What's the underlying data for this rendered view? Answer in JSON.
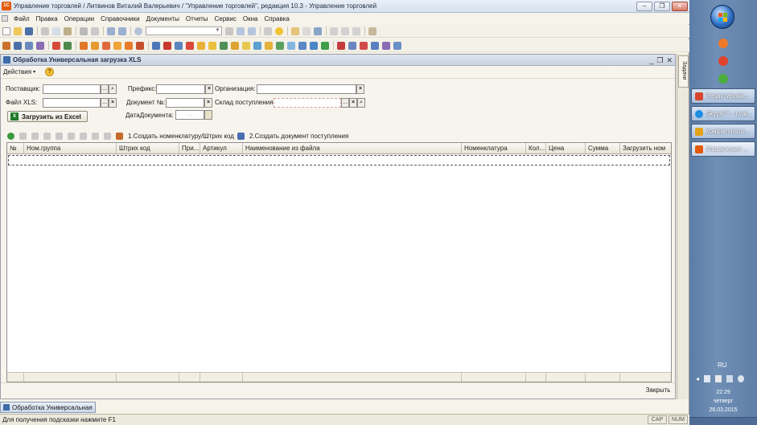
{
  "window": {
    "title": "Управление торговлей / Литвинов Виталий Валерьевич / \"Управление торговлей\", редакция 10.3 - Управление торговлей",
    "logo_text": "1С"
  },
  "menu": [
    "Файл",
    "Правка",
    "Операции",
    "Справочники",
    "Документы",
    "Отчеты",
    "Сервис",
    "Окна",
    "Справка"
  ],
  "document": {
    "title": "Обработка  Универсальная загрузка XLS",
    "actions_label": "Действия",
    "help_glyph": "?",
    "labels": {
      "supplier": "Поставщик:",
      "prefix": "Префикс:",
      "organization": "Организация:",
      "file_xls": "Файл XLS:",
      "doc_number": "Документ №:",
      "warehouse": "Склад поступления:",
      "doc_date": "ДатаДокумента:"
    },
    "date_value": " . .",
    "load_button": "Загрузить из Excel",
    "excel_icon_text": "X",
    "step1_label": "1.Создать номенклатуру/Штрих код",
    "step2_label": "2.Создать документ поступления",
    "columns": [
      "№",
      "Ном.группа",
      "Штрих код",
      "При...",
      "Артикул",
      "Наименование из файла",
      "Номенклатура",
      "Кол...",
      "Цена",
      "Сумма",
      "Загрузить ном"
    ],
    "close_label": "Закрыть"
  },
  "tasks_panel": {
    "label": "Задачи"
  },
  "window_tab": {
    "label": "Обработка  Универсальная ..."
  },
  "status": {
    "hint": "Для получения подсказки нажмите F1",
    "caps": "CAP",
    "num": "NUM"
  },
  "taskbar": {
    "buttons": [
      {
        "label": "Редактирова...",
        "icon_color": "#d8452b"
      },
      {
        "label": "Skype™ - l.val...",
        "icon_color": "#1e8fe1"
      },
      {
        "label": "Конфигурато...",
        "icon_color": "#e3a21a"
      },
      {
        "label": "Управление ...",
        "icon_color": "#e35a0c"
      }
    ],
    "language": "RU",
    "clock": {
      "time": "22:29",
      "day": "четверг",
      "date": "26.03.2015"
    }
  },
  "colors": {
    "accent": "#3d6ca8",
    "taskbar": "#6f8fb6",
    "brand_1c": "#e35a0c"
  }
}
